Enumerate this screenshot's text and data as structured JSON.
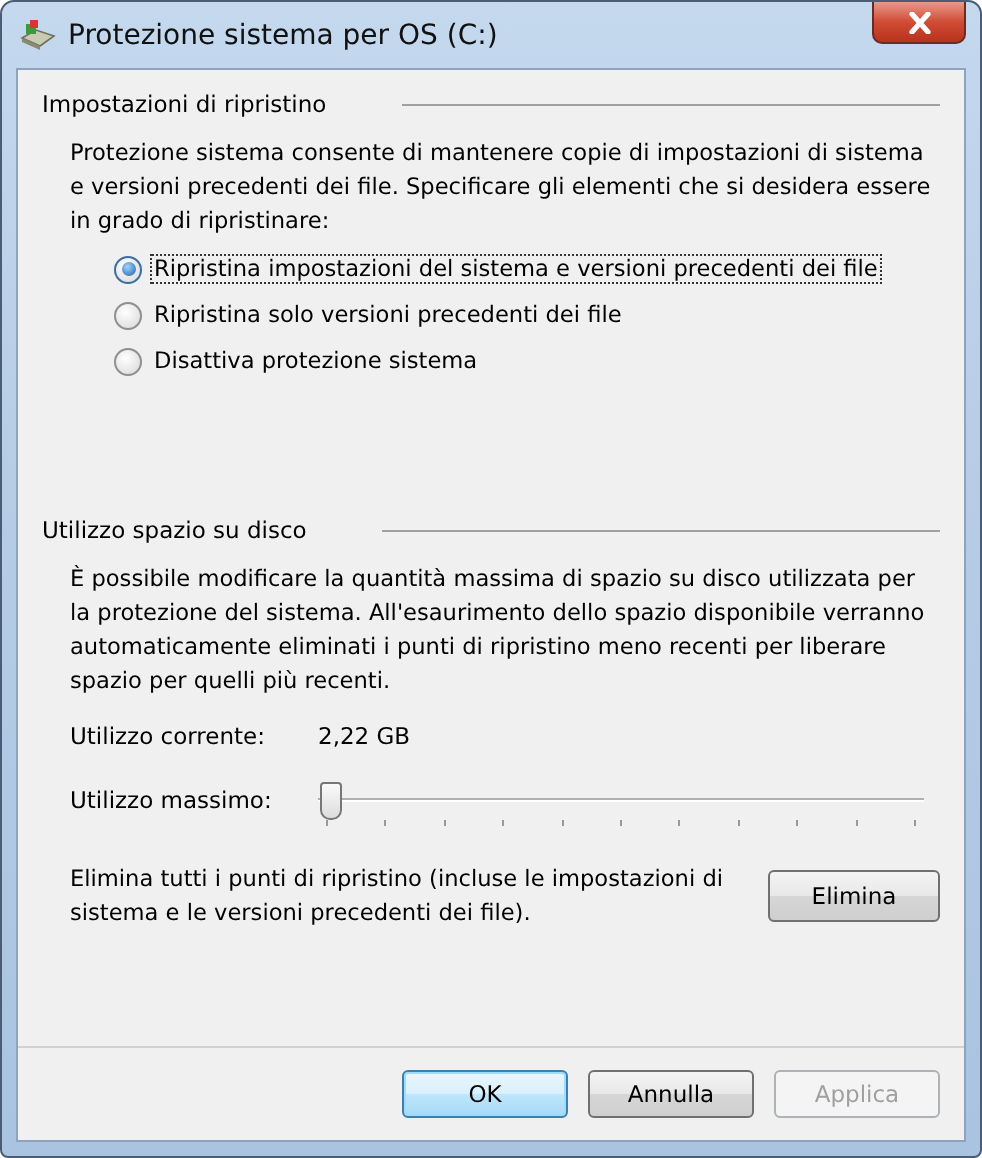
{
  "window": {
    "title": "Protezione sistema per OS (C:)"
  },
  "restore_settings": {
    "heading": "Impostazioni di ripristino",
    "description": "Protezione sistema consente di mantenere copie di impostazioni di sistema e versioni precedenti dei file. Specificare gli elementi che si desidera essere in grado di ripristinare:",
    "options": [
      {
        "label": "Ripristina impostazioni del sistema e versioni precedenti dei file",
        "selected": true
      },
      {
        "label": "Ripristina solo versioni precedenti dei file",
        "selected": false
      },
      {
        "label": "Disattiva protezione sistema",
        "selected": false
      }
    ]
  },
  "disk_usage": {
    "heading": "Utilizzo spazio su disco",
    "description": "È possibile modificare la quantità massima di spazio su disco utilizzata per la protezione del sistema. All'esaurimento dello spazio disponibile verranno automaticamente eliminati i punti di ripristino meno recenti per liberare spazio per quelli più recenti.",
    "current_label": "Utilizzo corrente:",
    "current_value": "2,22 GB",
    "max_label": "Utilizzo massimo:",
    "max_slider": {
      "level": 0.01
    },
    "delete_text": "Elimina tutti i punti di ripristino (incluse le impostazioni di sistema e le versioni precedenti dei file).",
    "delete_button": "Elimina"
  },
  "buttons": [
    {
      "label": "OK",
      "default": true,
      "disabled": false
    },
    {
      "label": "Annulla",
      "default": false,
      "disabled": false
    },
    {
      "label": "Applica",
      "default": false,
      "disabled": true
    }
  ]
}
